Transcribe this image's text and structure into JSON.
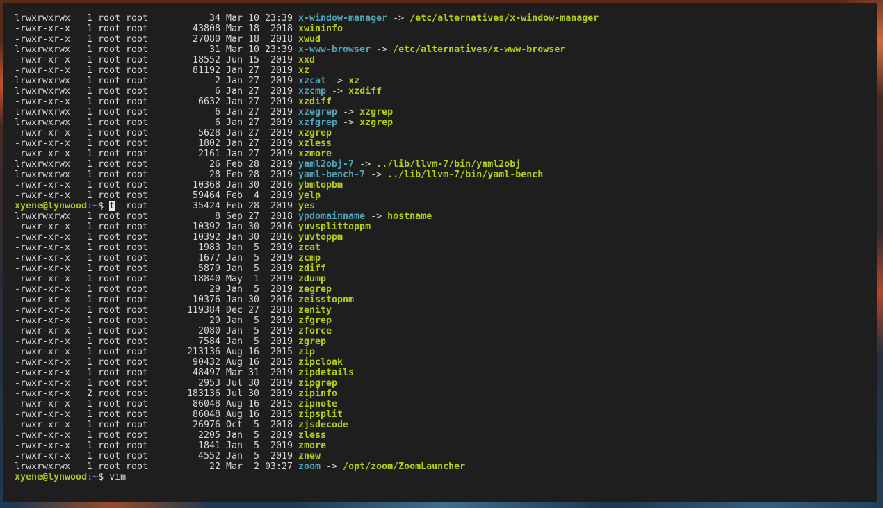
{
  "terminal": {
    "prompt": {
      "user_host": "xyene@lynwood",
      "path": ":~",
      "symbol": "$ "
    },
    "overlay_prompt_row": 18,
    "overlay_cursor_char": "t",
    "final_command": "vim",
    "listing": [
      {
        "perm": "lrwxrwxrwx",
        "links": "1",
        "user": "root",
        "group": "root",
        "size": "34",
        "date": "Mar 10 23:39",
        "name": "x-window-manager",
        "kind": "link",
        "target": "/etc/alternatives/x-window-manager"
      },
      {
        "perm": "-rwxr-xr-x",
        "links": "1",
        "user": "root",
        "group": "root",
        "size": "43808",
        "date": "Mar 18  2018",
        "name": "xwininfo",
        "kind": "exe",
        "target": ""
      },
      {
        "perm": "-rwxr-xr-x",
        "links": "1",
        "user": "root",
        "group": "root",
        "size": "27080",
        "date": "Mar 18  2018",
        "name": "xwud",
        "kind": "exe",
        "target": ""
      },
      {
        "perm": "lrwxrwxrwx",
        "links": "1",
        "user": "root",
        "group": "root",
        "size": "31",
        "date": "Mar 10 23:39",
        "name": "x-www-browser",
        "kind": "link",
        "target": "/etc/alternatives/x-www-browser"
      },
      {
        "perm": "-rwxr-xr-x",
        "links": "1",
        "user": "root",
        "group": "root",
        "size": "18552",
        "date": "Jun 15  2019",
        "name": "xxd",
        "kind": "exe",
        "target": ""
      },
      {
        "perm": "-rwxr-xr-x",
        "links": "1",
        "user": "root",
        "group": "root",
        "size": "81192",
        "date": "Jan 27  2019",
        "name": "xz",
        "kind": "exe",
        "target": ""
      },
      {
        "perm": "lrwxrwxrwx",
        "links": "1",
        "user": "root",
        "group": "root",
        "size": "2",
        "date": "Jan 27  2019",
        "name": "xzcat",
        "kind": "link",
        "target": "xz"
      },
      {
        "perm": "lrwxrwxrwx",
        "links": "1",
        "user": "root",
        "group": "root",
        "size": "6",
        "date": "Jan 27  2019",
        "name": "xzcmp",
        "kind": "link",
        "target": "xzdiff"
      },
      {
        "perm": "-rwxr-xr-x",
        "links": "1",
        "user": "root",
        "group": "root",
        "size": "6632",
        "date": "Jan 27  2019",
        "name": "xzdiff",
        "kind": "exe",
        "target": ""
      },
      {
        "perm": "lrwxrwxrwx",
        "links": "1",
        "user": "root",
        "group": "root",
        "size": "6",
        "date": "Jan 27  2019",
        "name": "xzegrep",
        "kind": "link",
        "target": "xzgrep"
      },
      {
        "perm": "lrwxrwxrwx",
        "links": "1",
        "user": "root",
        "group": "root",
        "size": "6",
        "date": "Jan 27  2019",
        "name": "xzfgrep",
        "kind": "link",
        "target": "xzgrep"
      },
      {
        "perm": "-rwxr-xr-x",
        "links": "1",
        "user": "root",
        "group": "root",
        "size": "5628",
        "date": "Jan 27  2019",
        "name": "xzgrep",
        "kind": "exe",
        "target": ""
      },
      {
        "perm": "-rwxr-xr-x",
        "links": "1",
        "user": "root",
        "group": "root",
        "size": "1802",
        "date": "Jan 27  2019",
        "name": "xzless",
        "kind": "exe",
        "target": ""
      },
      {
        "perm": "-rwxr-xr-x",
        "links": "1",
        "user": "root",
        "group": "root",
        "size": "2161",
        "date": "Jan 27  2019",
        "name": "xzmore",
        "kind": "exe",
        "target": ""
      },
      {
        "perm": "lrwxrwxrwx",
        "links": "1",
        "user": "root",
        "group": "root",
        "size": "26",
        "date": "Feb 28  2019",
        "name": "yaml2obj-7",
        "kind": "link",
        "target": "../lib/llvm-7/bin/yaml2obj"
      },
      {
        "perm": "lrwxrwxrwx",
        "links": "1",
        "user": "root",
        "group": "root",
        "size": "28",
        "date": "Feb 28  2019",
        "name": "yaml-bench-7",
        "kind": "link",
        "target": "../lib/llvm-7/bin/yaml-bench"
      },
      {
        "perm": "-rwxr-xr-x",
        "links": "1",
        "user": "root",
        "group": "root",
        "size": "10368",
        "date": "Jan 30  2016",
        "name": "ybmtopbm",
        "kind": "exe",
        "target": ""
      },
      {
        "perm": "-rwxr-xr-x",
        "links": "1",
        "user": "root",
        "group": "root",
        "size": "59464",
        "date": "Feb  4  2019",
        "name": "yelp",
        "kind": "exe",
        "target": ""
      },
      {
        "perm": "",
        "links": "",
        "user": "",
        "group": "root",
        "size": "35424",
        "date": "Feb 28  2019",
        "name": "yes",
        "kind": "exe",
        "target": ""
      },
      {
        "perm": "lrwxrwxrwx",
        "links": "1",
        "user": "root",
        "group": "root",
        "size": "8",
        "date": "Sep 27  2018",
        "name": "ypdomainname",
        "kind": "link",
        "target": "hostname"
      },
      {
        "perm": "-rwxr-xr-x",
        "links": "1",
        "user": "root",
        "group": "root",
        "size": "10392",
        "date": "Jan 30  2016",
        "name": "yuvsplittoppm",
        "kind": "exe",
        "target": ""
      },
      {
        "perm": "-rwxr-xr-x",
        "links": "1",
        "user": "root",
        "group": "root",
        "size": "10392",
        "date": "Jan 30  2016",
        "name": "yuvtoppm",
        "kind": "exe",
        "target": ""
      },
      {
        "perm": "-rwxr-xr-x",
        "links": "1",
        "user": "root",
        "group": "root",
        "size": "1983",
        "date": "Jan  5  2019",
        "name": "zcat",
        "kind": "exe",
        "target": ""
      },
      {
        "perm": "-rwxr-xr-x",
        "links": "1",
        "user": "root",
        "group": "root",
        "size": "1677",
        "date": "Jan  5  2019",
        "name": "zcmp",
        "kind": "exe",
        "target": ""
      },
      {
        "perm": "-rwxr-xr-x",
        "links": "1",
        "user": "root",
        "group": "root",
        "size": "5879",
        "date": "Jan  5  2019",
        "name": "zdiff",
        "kind": "exe",
        "target": ""
      },
      {
        "perm": "-rwxr-xr-x",
        "links": "1",
        "user": "root",
        "group": "root",
        "size": "18840",
        "date": "May  1  2019",
        "name": "zdump",
        "kind": "exe",
        "target": ""
      },
      {
        "perm": "-rwxr-xr-x",
        "links": "1",
        "user": "root",
        "group": "root",
        "size": "29",
        "date": "Jan  5  2019",
        "name": "zegrep",
        "kind": "exe",
        "target": ""
      },
      {
        "perm": "-rwxr-xr-x",
        "links": "1",
        "user": "root",
        "group": "root",
        "size": "10376",
        "date": "Jan 30  2016",
        "name": "zeisstopnm",
        "kind": "exe",
        "target": ""
      },
      {
        "perm": "-rwxr-xr-x",
        "links": "1",
        "user": "root",
        "group": "root",
        "size": "119384",
        "date": "Dec 27  2018",
        "name": "zenity",
        "kind": "exe",
        "target": ""
      },
      {
        "perm": "-rwxr-xr-x",
        "links": "1",
        "user": "root",
        "group": "root",
        "size": "29",
        "date": "Jan  5  2019",
        "name": "zfgrep",
        "kind": "exe",
        "target": ""
      },
      {
        "perm": "-rwxr-xr-x",
        "links": "1",
        "user": "root",
        "group": "root",
        "size": "2080",
        "date": "Jan  5  2019",
        "name": "zforce",
        "kind": "exe",
        "target": ""
      },
      {
        "perm": "-rwxr-xr-x",
        "links": "1",
        "user": "root",
        "group": "root",
        "size": "7584",
        "date": "Jan  5  2019",
        "name": "zgrep",
        "kind": "exe",
        "target": ""
      },
      {
        "perm": "-rwxr-xr-x",
        "links": "1",
        "user": "root",
        "group": "root",
        "size": "213136",
        "date": "Aug 16  2015",
        "name": "zip",
        "kind": "exe",
        "target": ""
      },
      {
        "perm": "-rwxr-xr-x",
        "links": "1",
        "user": "root",
        "group": "root",
        "size": "90432",
        "date": "Aug 16  2015",
        "name": "zipcloak",
        "kind": "exe",
        "target": ""
      },
      {
        "perm": "-rwxr-xr-x",
        "links": "1",
        "user": "root",
        "group": "root",
        "size": "48497",
        "date": "Mar 31  2019",
        "name": "zipdetails",
        "kind": "exe",
        "target": ""
      },
      {
        "perm": "-rwxr-xr-x",
        "links": "1",
        "user": "root",
        "group": "root",
        "size": "2953",
        "date": "Jul 30  2019",
        "name": "zipgrep",
        "kind": "exe",
        "target": ""
      },
      {
        "perm": "-rwxr-xr-x",
        "links": "2",
        "user": "root",
        "group": "root",
        "size": "183136",
        "date": "Jul 30  2019",
        "name": "zipinfo",
        "kind": "exe",
        "target": ""
      },
      {
        "perm": "-rwxr-xr-x",
        "links": "1",
        "user": "root",
        "group": "root",
        "size": "86048",
        "date": "Aug 16  2015",
        "name": "zipnote",
        "kind": "exe",
        "target": ""
      },
      {
        "perm": "-rwxr-xr-x",
        "links": "1",
        "user": "root",
        "group": "root",
        "size": "86048",
        "date": "Aug 16  2015",
        "name": "zipsplit",
        "kind": "exe",
        "target": ""
      },
      {
        "perm": "-rwxr-xr-x",
        "links": "1",
        "user": "root",
        "group": "root",
        "size": "26976",
        "date": "Oct  5  2018",
        "name": "zjsdecode",
        "kind": "exe",
        "target": ""
      },
      {
        "perm": "-rwxr-xr-x",
        "links": "1",
        "user": "root",
        "group": "root",
        "size": "2205",
        "date": "Jan  5  2019",
        "name": "zless",
        "kind": "exe",
        "target": ""
      },
      {
        "perm": "-rwxr-xr-x",
        "links": "1",
        "user": "root",
        "group": "root",
        "size": "1841",
        "date": "Jan  5  2019",
        "name": "zmore",
        "kind": "exe",
        "target": ""
      },
      {
        "perm": "-rwxr-xr-x",
        "links": "1",
        "user": "root",
        "group": "root",
        "size": "4552",
        "date": "Jan  5  2019",
        "name": "znew",
        "kind": "exe",
        "target": ""
      },
      {
        "perm": "lrwxrwxrwx",
        "links": "1",
        "user": "root",
        "group": "root",
        "size": "22",
        "date": "Mar  2 03:27",
        "name": "zoom",
        "kind": "link",
        "target": "/opt/zoom/ZoomLauncher"
      }
    ]
  }
}
